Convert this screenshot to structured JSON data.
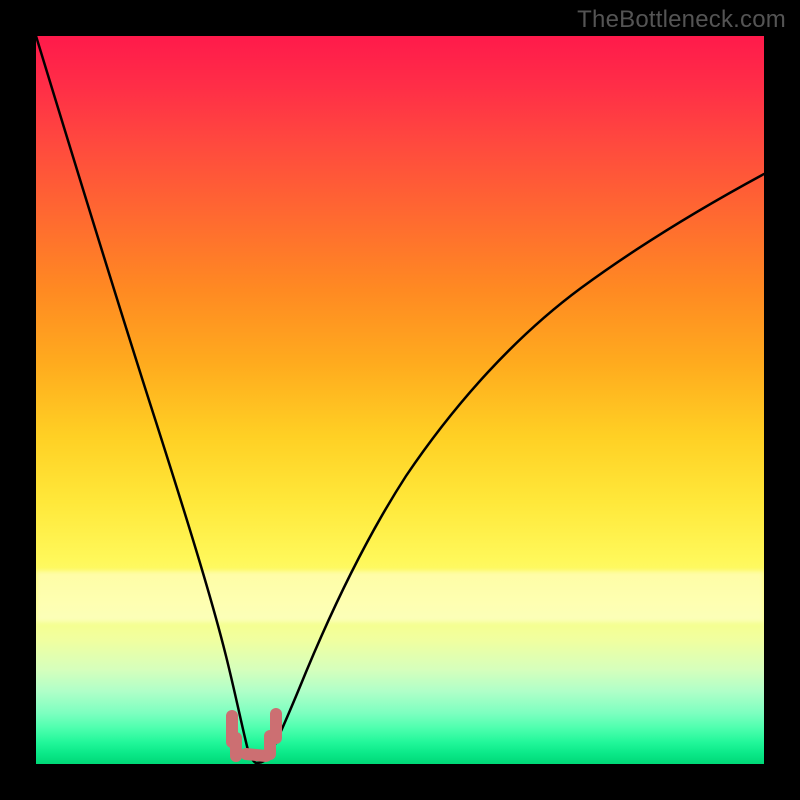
{
  "watermark": "TheBottleneck.com",
  "chart_data": {
    "type": "line",
    "title": "",
    "xlabel": "",
    "ylabel": "",
    "xlim": [
      0,
      100
    ],
    "ylim": [
      0,
      100
    ],
    "grid": false,
    "series": [
      {
        "name": "bottleneck-curve",
        "x": [
          0,
          5,
          10,
          15,
          20,
          22,
          24,
          26,
          27,
          28,
          29,
          30,
          31,
          32,
          34,
          37,
          40,
          45,
          50,
          55,
          60,
          65,
          70,
          75,
          80,
          85,
          90,
          95,
          100
        ],
        "values": [
          100,
          82,
          64,
          47,
          30,
          22,
          15,
          8,
          4,
          1.5,
          0.5,
          0.3,
          0.5,
          1.5,
          5,
          12,
          20,
          32,
          42,
          50,
          57,
          62.5,
          67,
          70.5,
          73.5,
          76,
          78,
          79.5,
          81
        ]
      }
    ],
    "minimum_markers": {
      "x": [
        27,
        28,
        29,
        30,
        31,
        32
      ],
      "values": [
        4,
        1.5,
        0.5,
        0.3,
        0.5,
        1.5
      ]
    },
    "background_gradient_stops": [
      {
        "pos": 0,
        "color": "#ff1a4b"
      },
      {
        "pos": 50,
        "color": "#ffc522"
      },
      {
        "pos": 80,
        "color": "#fcff7e"
      },
      {
        "pos": 100,
        "color": "#00d877"
      }
    ]
  }
}
